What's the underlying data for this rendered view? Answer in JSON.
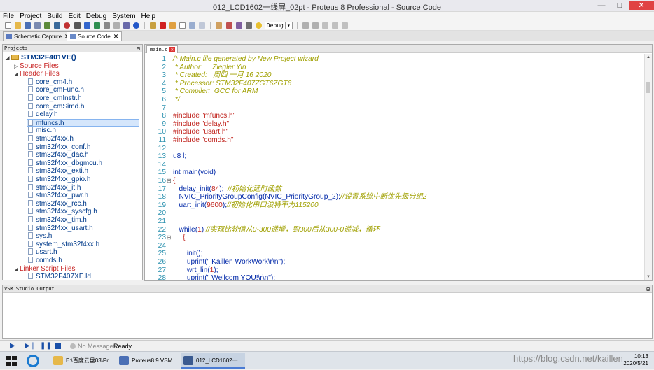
{
  "window": {
    "title": "012_LCD1602一线屏_02pt - Proteus 8 Professional - Source Code",
    "minimize": "—",
    "maximize": "□",
    "close": "✕"
  },
  "menu": [
    "File",
    "Project",
    "Build",
    "Edit",
    "Debug",
    "System",
    "Help"
  ],
  "toolbar": {
    "config_select": "Debug"
  },
  "doc_tabs": [
    {
      "label": "Schematic Capture",
      "close": "✕"
    },
    {
      "label": "Source Code",
      "close": "✕"
    }
  ],
  "projects": {
    "title": "Projects",
    "pin": "⊟",
    "tree": [
      {
        "label": "STM32F401VE()",
        "kind": "root"
      },
      {
        "label": "Source Files",
        "kind": "folder",
        "collapsed": true
      },
      {
        "label": "Header Files",
        "kind": "folder",
        "collapsed": false
      },
      {
        "label": "core_cm4.h",
        "kind": "file"
      },
      {
        "label": "core_cmFunc.h",
        "kind": "file"
      },
      {
        "label": "core_cmInstr.h",
        "kind": "file"
      },
      {
        "label": "core_cmSimd.h",
        "kind": "file"
      },
      {
        "label": "delay.h",
        "kind": "file"
      },
      {
        "label": "mfuncs.h",
        "kind": "file",
        "selected": true
      },
      {
        "label": "misc.h",
        "kind": "file"
      },
      {
        "label": "stm32f4xx.h",
        "kind": "file"
      },
      {
        "label": "stm32f4xx_conf.h",
        "kind": "file"
      },
      {
        "label": "stm32f4xx_dac.h",
        "kind": "file"
      },
      {
        "label": "stm32f4xx_dbgmcu.h",
        "kind": "file"
      },
      {
        "label": "stm32f4xx_exti.h",
        "kind": "file"
      },
      {
        "label": "stm32f4xx_gpio.h",
        "kind": "file"
      },
      {
        "label": "stm32f4xx_it.h",
        "kind": "file"
      },
      {
        "label": "stm32f4xx_pwr.h",
        "kind": "file"
      },
      {
        "label": "stm32f4xx_rcc.h",
        "kind": "file"
      },
      {
        "label": "stm32f4xx_syscfg.h",
        "kind": "file"
      },
      {
        "label": "stm32f4xx_tim.h",
        "kind": "file"
      },
      {
        "label": "stm32f4xx_usart.h",
        "kind": "file"
      },
      {
        "label": "sys.h",
        "kind": "file"
      },
      {
        "label": "system_stm32f4xx.h",
        "kind": "file"
      },
      {
        "label": "usart.h",
        "kind": "file"
      },
      {
        "label": "comds.h",
        "kind": "file"
      },
      {
        "label": "Linker Script Files",
        "kind": "folder",
        "collapsed": false
      },
      {
        "label": "STM32F407XE.ld",
        "kind": "file"
      }
    ]
  },
  "editor": {
    "tab": "main.c",
    "tab_close": "✕",
    "lines": [
      {
        "n": "1",
        "fold": "",
        "segs": [
          [
            "cmt",
            "/* Main.c file generated by New Project wizard"
          ]
        ]
      },
      {
        "n": "2",
        "fold": "",
        "segs": [
          [
            "cmt",
            " * Author:     Ziegler Yin"
          ]
        ]
      },
      {
        "n": "3",
        "fold": "",
        "segs": [
          [
            "cmt",
            " * Created:   周四 一月 16 2020"
          ]
        ]
      },
      {
        "n": "4",
        "fold": "",
        "segs": [
          [
            "cmt",
            " * Processor: STM32F407ZGT6ZGT6"
          ]
        ]
      },
      {
        "n": "5",
        "fold": "",
        "segs": [
          [
            "cmt",
            " * Compiler:  GCC for ARM"
          ]
        ]
      },
      {
        "n": "6",
        "fold": "",
        "segs": [
          [
            "cmt",
            " */"
          ]
        ]
      },
      {
        "n": "7",
        "fold": "",
        "segs": []
      },
      {
        "n": "8",
        "fold": "",
        "segs": [
          [
            "pp",
            "#include \"mfuncs.h\""
          ]
        ]
      },
      {
        "n": "9",
        "fold": "",
        "segs": [
          [
            "pp",
            "#include \"delay.h\""
          ]
        ]
      },
      {
        "n": "10",
        "fold": "",
        "segs": [
          [
            "pp",
            "#include \"usart.h\""
          ]
        ]
      },
      {
        "n": "11",
        "fold": "",
        "segs": [
          [
            "pp",
            "#include \"comds.h\""
          ]
        ]
      },
      {
        "n": "12",
        "fold": "",
        "segs": []
      },
      {
        "n": "13",
        "fold": "",
        "segs": [
          [
            "kw",
            "u8 l;"
          ]
        ]
      },
      {
        "n": "14",
        "fold": "",
        "segs": []
      },
      {
        "n": "15",
        "fold": "",
        "segs": [
          [
            "kw",
            "int main(void)"
          ]
        ]
      },
      {
        "n": "16",
        "fold": "⊟",
        "segs": [
          [
            "pp",
            "{"
          ]
        ]
      },
      {
        "n": "17",
        "fold": "",
        "segs": [
          [
            "fn",
            "   delay_init("
          ],
          [
            "num",
            "84"
          ],
          [
            "fn",
            ");  "
          ],
          [
            "cmt",
            "//初始化延时函数"
          ]
        ]
      },
      {
        "n": "18",
        "fold": "",
        "segs": [
          [
            "fn",
            "   NVIC_PriorityGroupConfig(NVIC_PriorityGroup_2);"
          ],
          [
            "cmt",
            "//设置系统中断优先级分组2"
          ]
        ]
      },
      {
        "n": "19",
        "fold": "",
        "segs": [
          [
            "fn",
            "   uart_init("
          ],
          [
            "num",
            "9600"
          ],
          [
            "fn",
            ");"
          ],
          [
            "cmt",
            "//初始化串口波特率为115200"
          ]
        ]
      },
      {
        "n": "20",
        "fold": "",
        "segs": []
      },
      {
        "n": "21",
        "fold": "",
        "segs": []
      },
      {
        "n": "22",
        "fold": "",
        "segs": [
          [
            "kw",
            "   while("
          ],
          [
            "num",
            "1"
          ],
          [
            "kw",
            ") "
          ],
          [
            "cmt",
            "//实现比较值从0-300递增，到300后从300-0递减，循环"
          ]
        ]
      },
      {
        "n": "23",
        "fold": "⊟",
        "segs": [
          [
            "pp",
            "     {"
          ]
        ]
      },
      {
        "n": "24",
        "fold": "",
        "segs": []
      },
      {
        "n": "25",
        "fold": "",
        "segs": [
          [
            "fn",
            "       init();"
          ]
        ]
      },
      {
        "n": "26",
        "fold": "",
        "segs": [
          [
            "fn",
            "       uprint(\" Kaillen WorkWork\\r\\n\");"
          ]
        ]
      },
      {
        "n": "27",
        "fold": "",
        "segs": [
          [
            "fn",
            "       wrt_lin("
          ],
          [
            "num",
            "1"
          ],
          [
            "fn",
            ");"
          ]
        ]
      },
      {
        "n": "28",
        "fold": "",
        "segs": [
          [
            "fn",
            "       uprint(\" Wellcom YOU!\\r\\n\");"
          ]
        ]
      },
      {
        "n": "29",
        "fold": "",
        "segs": [
          [
            "kw",
            "        for(l=0; l<255; l++) delay_ms(15);"
          ]
        ]
      }
    ]
  },
  "output": {
    "title": "VSM Studio Output",
    "pin": "⊟"
  },
  "status": {
    "messages": "No Messages",
    "state": "Ready"
  },
  "taskbar": {
    "items": [
      {
        "label": "E:\\百度云盘03\\Pr..."
      },
      {
        "label": "Proteus8.9 VSM..."
      },
      {
        "label": "012_LCD1602一..."
      }
    ],
    "clock_time": "10:13",
    "clock_date": "2020/5/21"
  },
  "watermark": "https://blog.csdn.net/kaillen",
  "colors": {
    "comment": "#a0a000",
    "preprocessor": "#c0221c",
    "keyword": "#0028a8",
    "line_number": "#2b91af",
    "selection": "#d5e6fb"
  }
}
